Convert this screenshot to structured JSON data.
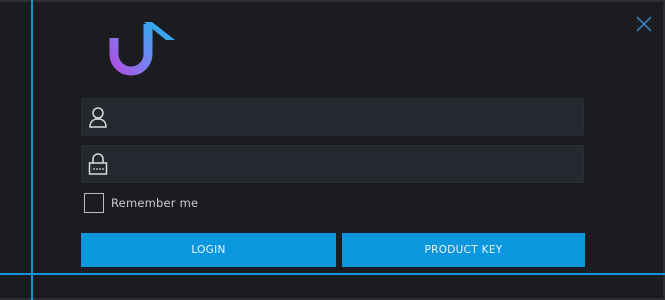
{
  "window": {
    "close_icon": "close-icon"
  },
  "logo": {
    "icon": "music-note-logo",
    "gradient_start": "#b04fe0",
    "gradient_end": "#3aa6ee"
  },
  "form": {
    "username": {
      "icon": "user-icon",
      "value": "",
      "placeholder": ""
    },
    "password": {
      "icon": "lock-icon",
      "value": "",
      "placeholder": ""
    },
    "remember": {
      "label": "Remember me",
      "checked": false
    }
  },
  "buttons": {
    "login_label": "LOGIN",
    "product_key_label": "PRODUCT KEY"
  },
  "colors": {
    "background": "#1b1c20",
    "field_background": "#262830",
    "accent": "#1592d8",
    "button": "#0b97dd",
    "text": "#c9cbd1"
  }
}
